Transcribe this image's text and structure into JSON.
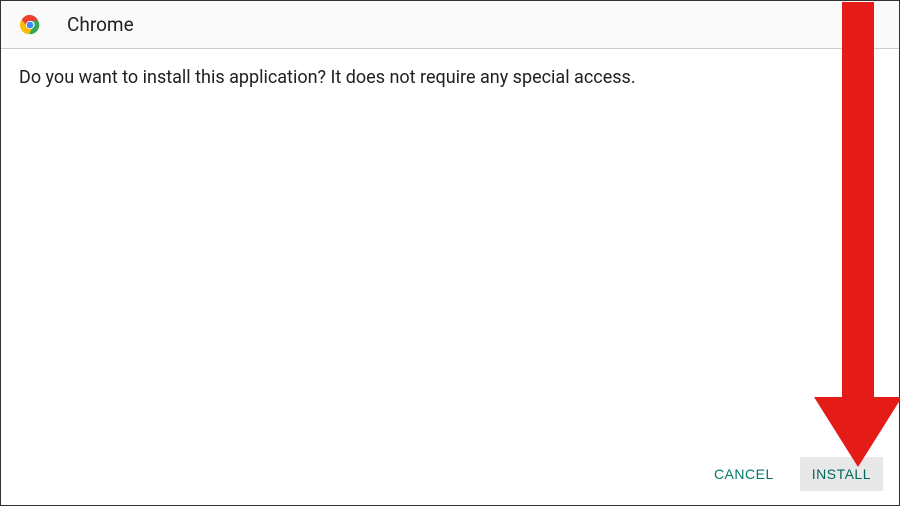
{
  "header": {
    "app_name": "Chrome"
  },
  "content": {
    "prompt": "Do you want to install this application? It does not require any special access."
  },
  "footer": {
    "cancel_label": "CANCEL",
    "install_label": "INSTALL"
  },
  "annotation": {
    "color": "#e41b17"
  }
}
